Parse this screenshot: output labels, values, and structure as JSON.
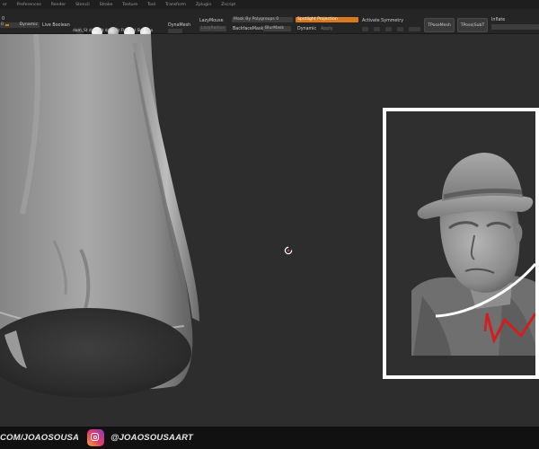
{
  "menu": [
    "er",
    "Preferences",
    "Render",
    "Stencil",
    "Stroke",
    "Texture",
    "Tool",
    "Transform",
    "Zplugin",
    "Zscript"
  ],
  "toolbar": {
    "number_left": "0",
    "number_left2": "0",
    "dynamic_label": "Dynamic",
    "live_boolean_label": "Live Boolean",
    "material_labels": "dam_St dam_St dam_St Flat Col SkinSha",
    "dynamesh_label": "DynaMesh",
    "lazymouse_label": "LazyMouse",
    "lazymouse_sub": "LazyRadius",
    "mask_polygroups_label": "Mask By Polygroups 0",
    "backface_mask_label": "BackfaceMask",
    "blurmask_label": "BlurMask",
    "spotlight_label": "Spotlight Projection",
    "dynamic2_label": "Dynamic",
    "apply_label": "Apply",
    "activate_symmetry_label": "Activate Symmetry",
    "tposemesh_label": "TPoseMesh",
    "tposesubt_label": "TPose|SubT",
    "inflate_label": "Inflate",
    "accent_color": "#d9781c"
  },
  "footer": {
    "left_text": "COM/JOAOSOUSA",
    "right_text": "@JOAOSOUSAART"
  },
  "icons": [
    "rotate-cursor-icon",
    "instagram-icon"
  ]
}
